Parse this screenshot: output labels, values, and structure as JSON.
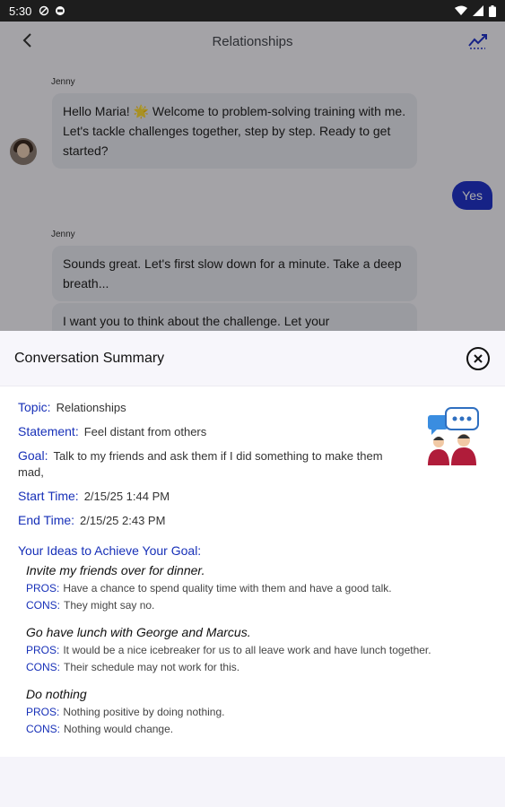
{
  "status": {
    "time": "5:30"
  },
  "appbar": {
    "title": "Relationships"
  },
  "chat": {
    "messages": [
      {
        "sender": "Jenny",
        "text": "Hello Maria! 🌟 Welcome to problem-solving training with me.  Let's tackle challenges together, step by step. Ready to get started?"
      },
      {
        "reply": "Yes"
      },
      {
        "sender": "Jenny",
        "text": "Sounds great.  Let's first slow down for a minute.  Take a deep breath..."
      },
      {
        "text": "I want you to think about the challenge. Let your"
      }
    ]
  },
  "summary": {
    "title": "Conversation Summary",
    "topic": {
      "label": "Topic:",
      "value": "Relationships"
    },
    "statement": {
      "label": "Statement:",
      "value": "Feel distant from others"
    },
    "goal": {
      "label": "Goal:",
      "value": "Talk to my friends and ask them if I did something to make them mad,"
    },
    "start": {
      "label": "Start Time:",
      "value": "2/15/25  1:44 PM"
    },
    "end": {
      "label": "End Time:",
      "value": "2/15/25  2:43 PM"
    },
    "ideas_title": "Your Ideas to Achieve Your Goal:",
    "pros_label": "PROS:",
    "cons_label": "CONS:",
    "ideas": [
      {
        "name": "Invite my friends over for dinner.",
        "pros": "Have a chance to spend quality time with them and have a good talk.",
        "cons": "They might say no."
      },
      {
        "name": "Go have lunch with George and Marcus.",
        "pros": "It would be a nice icebreaker for us to all leave work and have lunch together.",
        "cons": "Their schedule may not work for this."
      },
      {
        "name": "Do nothing",
        "pros": "Nothing positive by doing nothing.",
        "cons": "Nothing would change."
      }
    ]
  },
  "icons": {
    "back": "arrow-left-icon",
    "trend": "trending-icon",
    "close": "close-circle-icon",
    "people": "people-chat-icon"
  },
  "colors": {
    "accent": "#1730b8",
    "reply_bubble": "#2234c8",
    "bubble": "#e6e7ef"
  }
}
